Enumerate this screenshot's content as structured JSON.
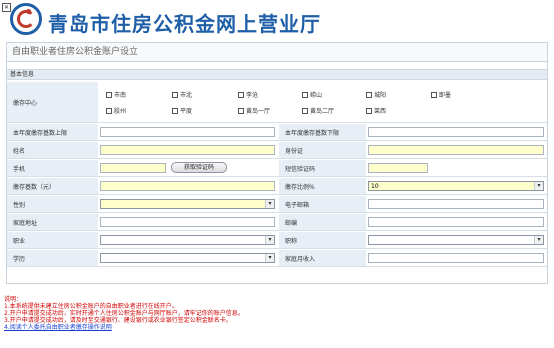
{
  "header": {
    "title": "青岛市住房公积金网上营业厅"
  },
  "panel": {
    "title": "自由职业者住房公积金账户设立"
  },
  "section": {
    "title": "基本信息"
  },
  "center": {
    "label": "缴存中心",
    "options_row1": [
      "市南",
      "市北",
      "李沧",
      "崂山",
      "城阳",
      "即墨"
    ],
    "options_row2": [
      "胶州",
      "平度",
      "黄岛一厅",
      "黄岛二厅",
      "莱西"
    ]
  },
  "fields": {
    "prev_base_upper_label": "本年度缴存基数上限",
    "prev_base_lower_label": "本年度缴存基数下限",
    "name_label": "姓名",
    "id_label": "身份证",
    "phone_label": "手机",
    "get_code_label": "获取验证码",
    "sms_label": "短信验证码",
    "base_label": "缴存基数（元）",
    "ratio_label": "缴存比例%",
    "ratio_value": "10",
    "gender_label": "性别",
    "email_label": "电子邮箱",
    "address_label": "家庭地址",
    "postcode_label": "邮编",
    "job_label": "职业",
    "title_label": "职称",
    "edu_label": "学历",
    "income_label": "家庭月收入"
  },
  "notes": {
    "head": "说明：",
    "items": [
      "1.本系统提供未建立住房公积金账户的自由职业者进行在线开户。",
      "2.开户申请提交成功后，实时开通个人住房公积金账户与网厅账户，请牢记你的账户信息。",
      "3.开户申请提交成功后，请及时至交通银行、建设银行或农业银行签定公积金联名卡。"
    ],
    "link": "4.阅读个人委托自由职业者缴存操作说明"
  }
}
